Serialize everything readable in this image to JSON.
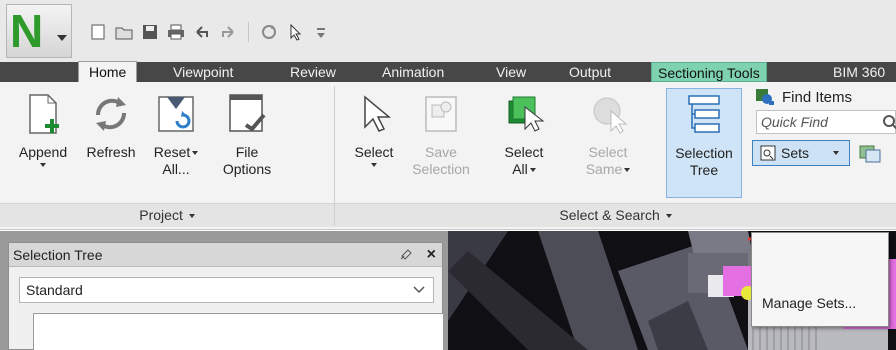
{
  "app": {
    "logo_letter": "N",
    "accent_green": "#2e9a2a"
  },
  "quick_access": [
    "new-file-icon",
    "open-folder-icon",
    "save-icon",
    "print-icon",
    "undo-icon",
    "redo-icon",
    "refresh-icon",
    "select-cursor-icon",
    "customize-icon"
  ],
  "menu_tabs": {
    "home": "Home",
    "viewpoint": "Viewpoint",
    "review": "Review",
    "animation": "Animation",
    "view": "View",
    "output": "Output",
    "sectioning_tools": "Sectioning Tools",
    "bim360": "BIM 360"
  },
  "ribbon": {
    "project": {
      "append": "Append",
      "refresh": "Refresh",
      "reset_all_line1": "Reset",
      "reset_all_line2": "All...",
      "file_options_line1": "File",
      "file_options_line2": "Options",
      "group_label": "Project"
    },
    "select_search": {
      "select": "Select",
      "save_selection_line1": "Save",
      "save_selection_line2": "Selection",
      "select_all_line1": "Select",
      "select_all_line2": "All",
      "select_same_line1": "Select",
      "select_same_line2": "Same",
      "selection_tree_line1": "Selection",
      "selection_tree_line2": "Tree",
      "group_label": "Select & Search",
      "find_items": "Find Items",
      "quick_find_placeholder": "Quick Find",
      "sets": "Sets"
    }
  },
  "selection_tree_panel": {
    "title": "Selection Tree",
    "close": "×",
    "view_mode": "Standard"
  },
  "sets_dropdown": {
    "manage_sets": "Manage Sets..."
  }
}
